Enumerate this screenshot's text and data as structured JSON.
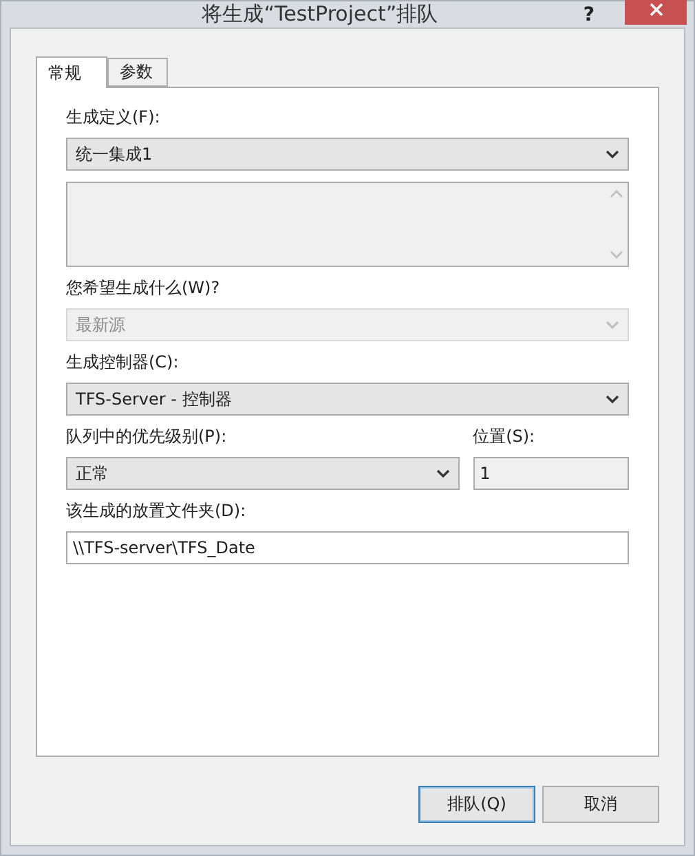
{
  "window": {
    "title": "将生成“TestProject”排队",
    "help": "?"
  },
  "tabs": [
    {
      "label": "常规",
      "selected": true
    },
    {
      "label": "参数",
      "selected": false
    }
  ],
  "definition": {
    "label": "生成定义(F):",
    "value": "统一集成1"
  },
  "description": {
    "disabled": true
  },
  "what_to_build": {
    "label": "您希望生成什么(W)?",
    "value": "最新源",
    "disabled": true
  },
  "controller": {
    "label": "生成控制器(C):",
    "value": "TFS-Server - 控制器"
  },
  "priority": {
    "label": "队列中的优先级别(P):",
    "value": "正常"
  },
  "position": {
    "label": "位置(S):",
    "value": "1",
    "disabled": true
  },
  "drop_folder": {
    "label": "该生成的放置文件夹(D):",
    "value": "\\\\TFS-server\\TFS_Date"
  },
  "buttons": [
    {
      "label": "排队(Q)",
      "default": true
    },
    {
      "label": "取消",
      "default": false
    }
  ]
}
